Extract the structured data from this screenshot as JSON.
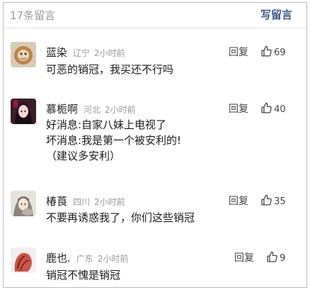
{
  "header": {
    "count_label": "17条留言",
    "write_label": "写留言"
  },
  "comments": [
    {
      "name": "蓝染",
      "location": "辽宁",
      "time": "2小时前",
      "reply_label": "回复",
      "likes": "69",
      "lines": [
        "可恶的销冠，我买还不行吗"
      ]
    },
    {
      "name": "慕栀啊",
      "location": "河北",
      "time": "2小时前",
      "reply_label": "回复",
      "likes": "40",
      "lines": [
        "好消息:自家八妹上电视了",
        "坏消息:我是第一个被安利的!",
        "（建议多安利）"
      ]
    },
    {
      "name": "椿莨",
      "location": "四川",
      "time": "2小时前",
      "reply_label": "回复",
      "likes": "35",
      "lines": [
        "不要再诱惑我了，你们这些销冠"
      ]
    },
    {
      "name": "鹿也.",
      "location": "广东",
      "time": "2小时前",
      "reply_label": "回复",
      "likes": "9",
      "lines": [
        "销冠不愧是销冠"
      ]
    }
  ]
}
